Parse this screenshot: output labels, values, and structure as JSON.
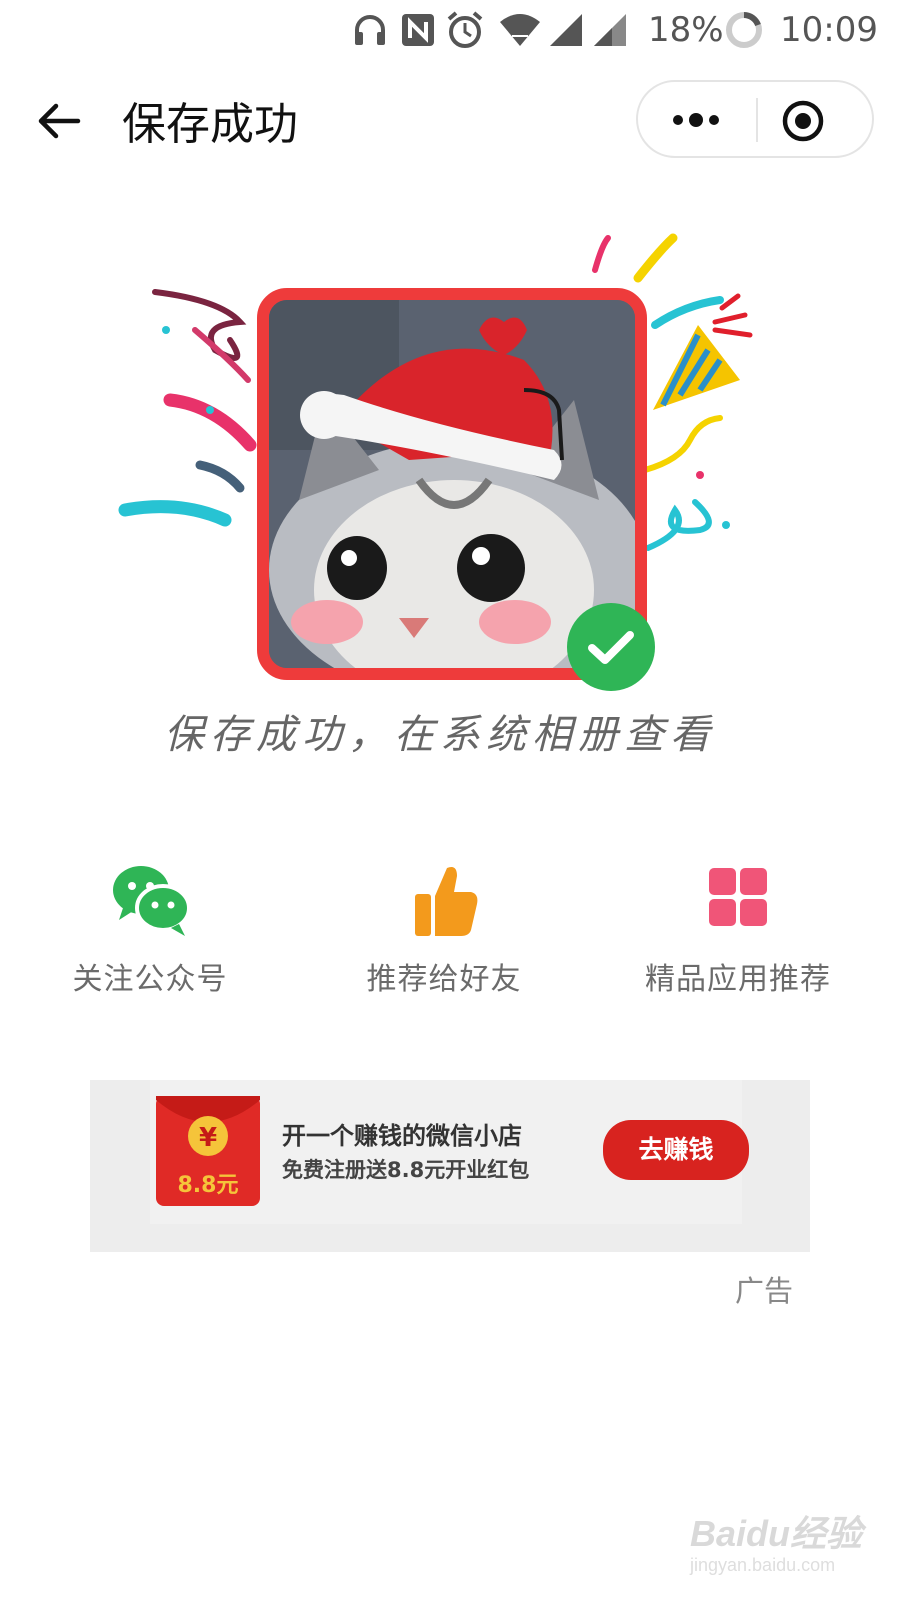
{
  "status_bar": {
    "battery": "18%",
    "time": "10:09",
    "icons": [
      "headphones-icon",
      "nfc-icon",
      "alarm-icon",
      "wifi-icon",
      "signal-icon",
      "signal-icon-2",
      "battery-ring-icon"
    ]
  },
  "nav": {
    "back_icon": "back-arrow-icon",
    "title": "保存成功",
    "menu_icon": "more-dots-icon",
    "close_icon": "close-target-icon"
  },
  "hero": {
    "caption": "保存成功，在系统相册查看",
    "check_icon": "check-circle-icon",
    "frame_color": "#ee3b3b",
    "check_color": "#2fb556"
  },
  "actions": [
    {
      "label": "关注公众号",
      "icon": "wechat-icon",
      "color": "#2fb556"
    },
    {
      "label": "推荐给好友",
      "icon": "thumbs-up-icon",
      "color": "#f39a1c"
    },
    {
      "label": "精品应用推荐",
      "icon": "grid-apps-icon",
      "color": "#f05578"
    }
  ],
  "ad": {
    "title": "开一个赚钱的微信小店",
    "subtitle": "免费注册送8.8元开业红包",
    "button": "去赚钱",
    "envelope_amount": "8.8元",
    "envelope_symbol": "¥",
    "label": "广告"
  },
  "watermark": {
    "brand": "Baidu经验",
    "url": "jingyan.baidu.com"
  }
}
